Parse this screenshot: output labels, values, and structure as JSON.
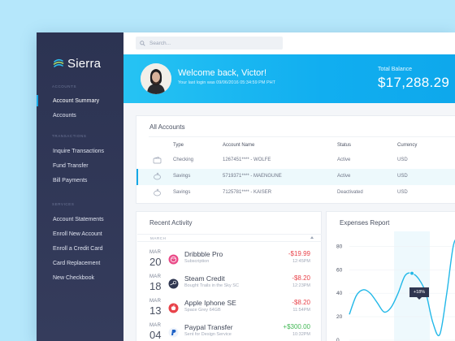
{
  "app": {
    "name": "Sierra",
    "accent": "#15a8e6"
  },
  "sidebar": {
    "sections": [
      {
        "title": "ACCOUNTS",
        "items": [
          {
            "label": "Account Summary",
            "active": true
          },
          {
            "label": "Accounts"
          }
        ]
      },
      {
        "title": "TRANSACTIONS",
        "items": [
          {
            "label": "Inquire Transactions"
          },
          {
            "label": "Fund Transfer"
          },
          {
            "label": "Bill Payments"
          }
        ]
      },
      {
        "title": "SERVICES",
        "items": [
          {
            "label": "Account Statements"
          },
          {
            "label": "Enroll New Account"
          },
          {
            "label": "Enroll a Credit Card"
          },
          {
            "label": "Card Replacement"
          },
          {
            "label": "New Checkbook"
          }
        ]
      }
    ]
  },
  "search": {
    "placeholder": "Search..."
  },
  "hero": {
    "welcome": "Welcome back, Victor!",
    "last_login": "Your last login was 09/06/2016 05:34:59 PM PHT",
    "balance_label": "Total Balance",
    "balance_value": "$17,288.29"
  },
  "accounts": {
    "title": "All Accounts",
    "columns": [
      "Type",
      "Account Name",
      "Status",
      "Currency"
    ],
    "rows": [
      {
        "type": "Checking",
        "name": "1267451**** - WOLFE",
        "status": "Active",
        "currency": "USD",
        "icon": "wallet-icon"
      },
      {
        "type": "Savings",
        "name": "5719371**** - MAENGUNE",
        "status": "Active",
        "currency": "USD",
        "icon": "piggy-bank-icon",
        "selected": true
      },
      {
        "type": "Savings",
        "name": "7125781**** - KAISER",
        "status": "Deactivated",
        "currency": "USD",
        "icon": "piggy-bank-icon"
      }
    ]
  },
  "activity": {
    "title": "Recent Activity",
    "month": "MARCH",
    "items": [
      {
        "mon": "MAR",
        "day": "20",
        "name": "Dribbble Pro",
        "sub": "Subscription",
        "amount": "-$19.99",
        "kind": "neg",
        "time": "12:45PM",
        "logo": "dribbble-icon",
        "logo_color": "#ea4c89"
      },
      {
        "mon": "MAR",
        "day": "18",
        "name": "Steam Credit",
        "sub": "Bought Trails in the Sky SC",
        "amount": "-$8.20",
        "kind": "neg",
        "time": "12:23PM",
        "logo": "steam-icon",
        "logo_color": "#2f3650"
      },
      {
        "mon": "MAR",
        "day": "13",
        "name": "Apple Iphone SE",
        "sub": "Space Grey 64GB",
        "amount": "-$8.20",
        "kind": "neg",
        "time": "11:54PM",
        "logo": "apple-icon",
        "logo_color": "#e8434a"
      },
      {
        "mon": "MAR",
        "day": "04",
        "name": "Paypal Transfer",
        "sub": "Sent for Design Service",
        "amount": "+$300.00",
        "kind": "pos",
        "time": "10:32PM",
        "logo": "paypal-icon",
        "logo_color": "#1e62c6"
      }
    ]
  },
  "expenses": {
    "title": "Expenses Report",
    "tooltip": "+18%"
  },
  "chart_data": {
    "type": "line",
    "y_ticks": [
      80,
      60,
      40,
      20,
      0
    ],
    "ylim": [
      0,
      90
    ],
    "x": [
      0,
      1,
      2,
      3,
      4,
      5,
      6,
      7,
      8,
      9,
      10,
      11,
      12,
      13,
      14,
      15,
      16
    ],
    "values": [
      22,
      38,
      43,
      40,
      32,
      24,
      28,
      40,
      55,
      57,
      52,
      40,
      15,
      5,
      40,
      82,
      87
    ],
    "highlight_index": 9,
    "color": "#22b8e8"
  }
}
